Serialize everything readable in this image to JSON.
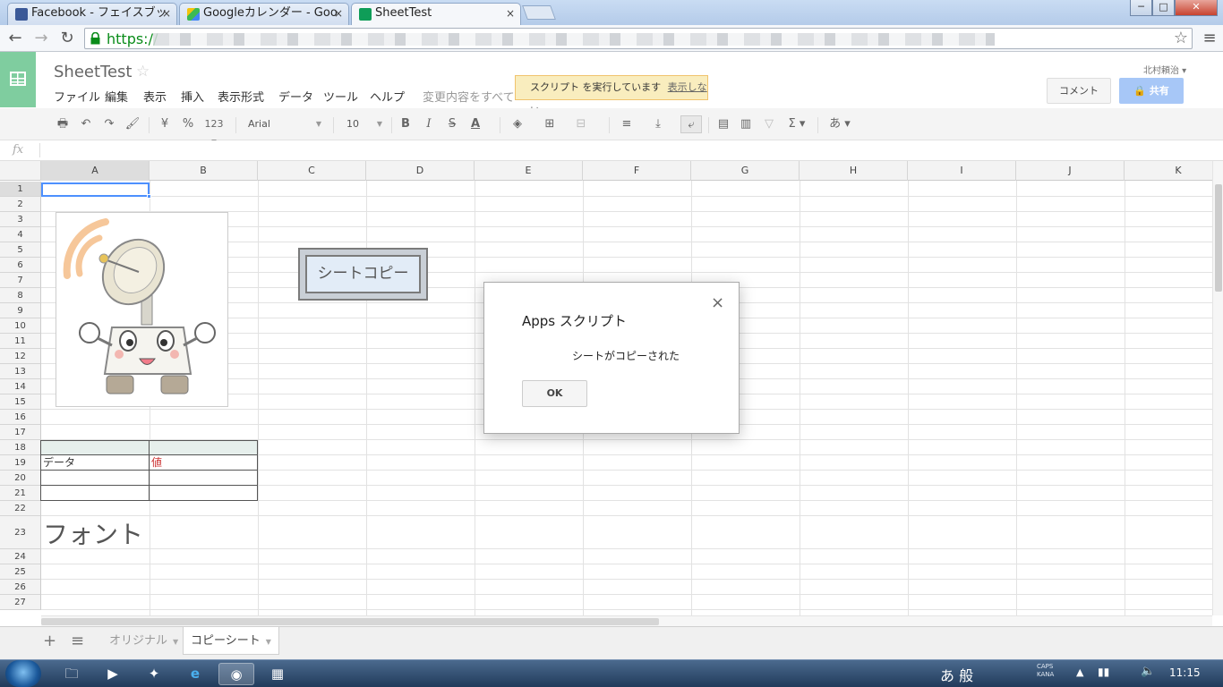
{
  "browser": {
    "tabs": [
      {
        "title": "Facebook - フェイスブッ",
        "close": "×"
      },
      {
        "title": "Googleカレンダー - Goo",
        "close": "×"
      },
      {
        "title": "SheetTest",
        "close": "×"
      }
    ],
    "url_prefix": "https://",
    "window_controls": {
      "min": "─",
      "max": "□",
      "close": "✕"
    }
  },
  "app": {
    "title": "SheetTest",
    "star": "☆",
    "menu": [
      "ファイル",
      "編集",
      "表示",
      "挿入",
      "表示形式",
      "データ",
      "ツール",
      "ヘルプ"
    ],
    "save_status": "変更内容をすべて",
    "script_banner": {
      "text": "スクリプト を実行しています",
      "link": "表示しない"
    },
    "user": "北村頼治",
    "comment_button": "コメント",
    "share_button": "共有"
  },
  "toolbar": {
    "currency": "¥",
    "percent": "%",
    "number_format": "123",
    "font": "Arial",
    "size": "10",
    "bold": "B",
    "italic": "I",
    "strike": "S",
    "text_color": "A",
    "sum": "Σ",
    "input_tool": "あ"
  },
  "formula_bar": {
    "label": "fx",
    "value": ""
  },
  "grid": {
    "columns": [
      "A",
      "B",
      "C",
      "D",
      "E",
      "F",
      "G",
      "H",
      "I",
      "J",
      "K"
    ],
    "rows": [
      "1",
      "2",
      "3",
      "4",
      "5",
      "6",
      "7",
      "8",
      "9",
      "10",
      "11",
      "12",
      "13",
      "14",
      "15",
      "16",
      "17",
      "18",
      "19",
      "20",
      "21",
      "22",
      "23",
      "24",
      "25",
      "26",
      "27"
    ],
    "selected_cell": "A1",
    "table": {
      "row19": {
        "a": "データ",
        "b": "値"
      }
    },
    "font_cell": "フォント",
    "drawing_button": "シートコピー"
  },
  "sheets": {
    "add": "+",
    "list": "≡",
    "tabs": [
      "オリジナル",
      "コピーシート"
    ],
    "active": "コピーシート"
  },
  "dialog": {
    "title": "Apps スクリプト",
    "message": "シートがコピーされた",
    "ok": "OK",
    "close": "×"
  },
  "taskbar": {
    "ime": "あ 般",
    "caps": "CAPS",
    "kana": "KANA",
    "clock": "11:15"
  },
  "colors": {
    "accent_green": "#7fcd9f",
    "share_blue": "#a7c7f7",
    "banner_yellow": "#f9edbe",
    "selection_blue": "#4d90fe",
    "value_red": "#cc3333"
  }
}
